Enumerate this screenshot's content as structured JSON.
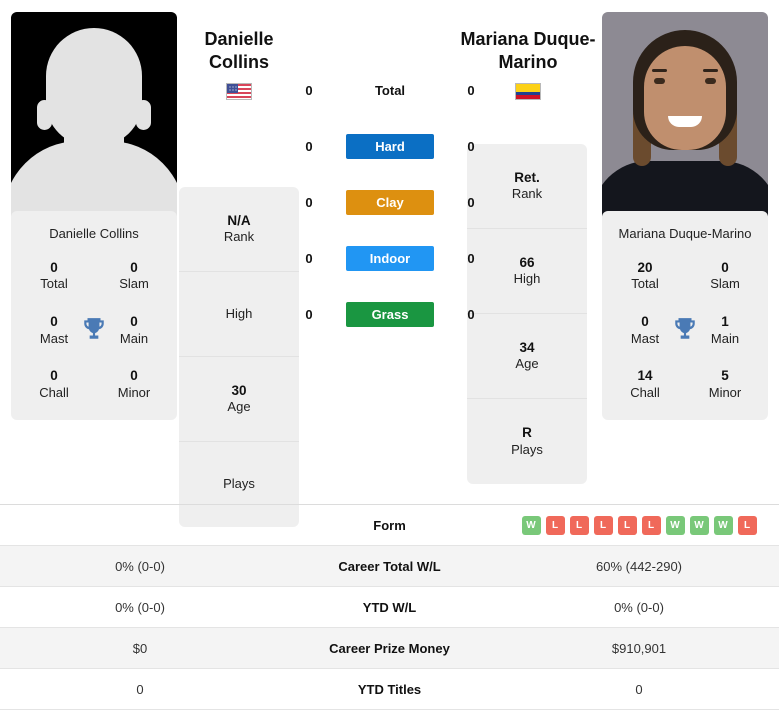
{
  "players": {
    "left": {
      "name": "Danielle Collins",
      "name_line1": "Danielle",
      "name_line2": "Collins",
      "flag": "us-flag",
      "photo": "silhouette-placeholder",
      "caption": "Danielle Collins",
      "attributes": [
        {
          "value": "N/A",
          "label": "Rank"
        },
        {
          "value": "",
          "label": "High"
        },
        {
          "value": "30",
          "label": "Age"
        },
        {
          "value": "",
          "label": "Plays"
        }
      ],
      "titles": {
        "total": "0",
        "total_label": "Total",
        "slam": "0",
        "slam_label": "Slam",
        "mast": "0",
        "mast_label": "Mast",
        "main": "0",
        "main_label": "Main",
        "chall": "0",
        "chall_label": "Chall",
        "minor": "0",
        "minor_label": "Minor"
      },
      "surface_wins": {
        "total": "0",
        "hard": "0",
        "clay": "0",
        "indoor": "0",
        "grass": "0"
      },
      "form": [],
      "career_wl": "0% (0-0)",
      "ytd_wl": "0% (0-0)",
      "prize_money": "$0",
      "ytd_titles": "0"
    },
    "right": {
      "name": "Mariana Duque-Marino",
      "name_line1": "Mariana Duque-",
      "name_line2": "Marino",
      "flag": "co-flag",
      "photo": "player-portrait",
      "caption": "Mariana Duque-Marino",
      "attributes": [
        {
          "value": "Ret.",
          "label": "Rank"
        },
        {
          "value": "66",
          "label": "High"
        },
        {
          "value": "34",
          "label": "Age"
        },
        {
          "value": "R",
          "label": "Plays"
        }
      ],
      "titles": {
        "total": "20",
        "total_label": "Total",
        "slam": "0",
        "slam_label": "Slam",
        "mast": "0",
        "mast_label": "Mast",
        "main": "1",
        "main_label": "Main",
        "chall": "14",
        "chall_label": "Chall",
        "minor": "5",
        "minor_label": "Minor"
      },
      "surface_wins": {
        "total": "0",
        "hard": "0",
        "clay": "0",
        "indoor": "0",
        "grass": "0"
      },
      "form": [
        "W",
        "L",
        "L",
        "L",
        "L",
        "L",
        "W",
        "W",
        "W",
        "L"
      ],
      "career_wl": "60% (442-290)",
      "ytd_wl": "0% (0-0)",
      "prize_money": "$910,901",
      "ytd_titles": "0"
    }
  },
  "surfaces": [
    {
      "key": "total",
      "label": "Total",
      "color": "transparent",
      "plain": true
    },
    {
      "key": "hard",
      "label": "Hard",
      "color": "#0b6fc4"
    },
    {
      "key": "clay",
      "label": "Clay",
      "color": "#dd9010"
    },
    {
      "key": "indoor",
      "label": "Indoor",
      "color": "#2196f3"
    },
    {
      "key": "grass",
      "label": "Grass",
      "color": "#1a9641"
    }
  ],
  "table": {
    "rows": [
      {
        "label": "Form",
        "type": "form",
        "left": "",
        "right": ""
      },
      {
        "label": "Career Total W/L",
        "type": "text",
        "left": "0% (0-0)",
        "right": "60% (442-290)"
      },
      {
        "label": "YTD W/L",
        "type": "text",
        "left": "0% (0-0)",
        "right": "0% (0-0)"
      },
      {
        "label": "Career Prize Money",
        "type": "text",
        "left": "$0",
        "right": "$910,901"
      },
      {
        "label": "YTD Titles",
        "type": "text",
        "left": "0",
        "right": "0"
      }
    ]
  },
  "colors": {
    "hard": "#0b6fc4",
    "clay": "#dd9010",
    "indoor": "#2196f3",
    "grass": "#1a9641",
    "win_badge": "#79c879",
    "loss_badge": "#f0695a",
    "trophy": "#4a7ab5",
    "card_bg": "#efefef"
  }
}
